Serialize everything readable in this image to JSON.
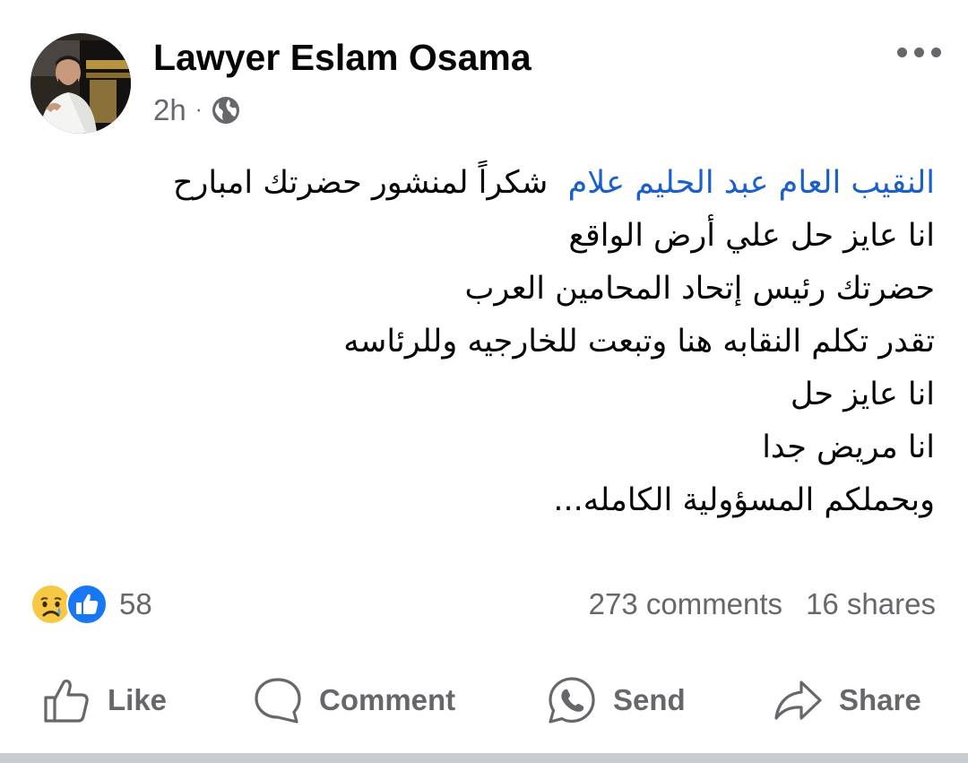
{
  "post": {
    "author": "Lawyer Eslam Osama",
    "time": "2h",
    "separator": "·",
    "privacy_icon": "globe-icon",
    "more_icon": "more-options-icon",
    "body": {
      "line1_tag": "النقيب العام عبد الحليم علام",
      "line1_rest": "شكراً لمنشور حضرتك امبارح",
      "lines": [
        "انا عايز حل علي أرض الواقع",
        "حضرتك رئيس إتحاد المحامين العرب",
        "تقدر تكلم النقابه هنا وتبعت للخارجيه وللرئاسه",
        "انا عايز حل",
        "انا مريض جدا",
        "وبحملكم المسؤولية الكامله..."
      ]
    },
    "reactions": {
      "icons": [
        "sad-reaction-icon",
        "like-reaction-icon"
      ],
      "count": "58"
    },
    "stats": {
      "comments": "273 comments",
      "shares": "16 shares"
    },
    "actions": {
      "like": "Like",
      "comment": "Comment",
      "send": "Send",
      "share": "Share"
    },
    "colors": {
      "tag_link": "#1b5fc8",
      "secondary_text": "#65676b",
      "like_blue": "#1877f2",
      "sad_yellow": "#f7c844"
    }
  }
}
